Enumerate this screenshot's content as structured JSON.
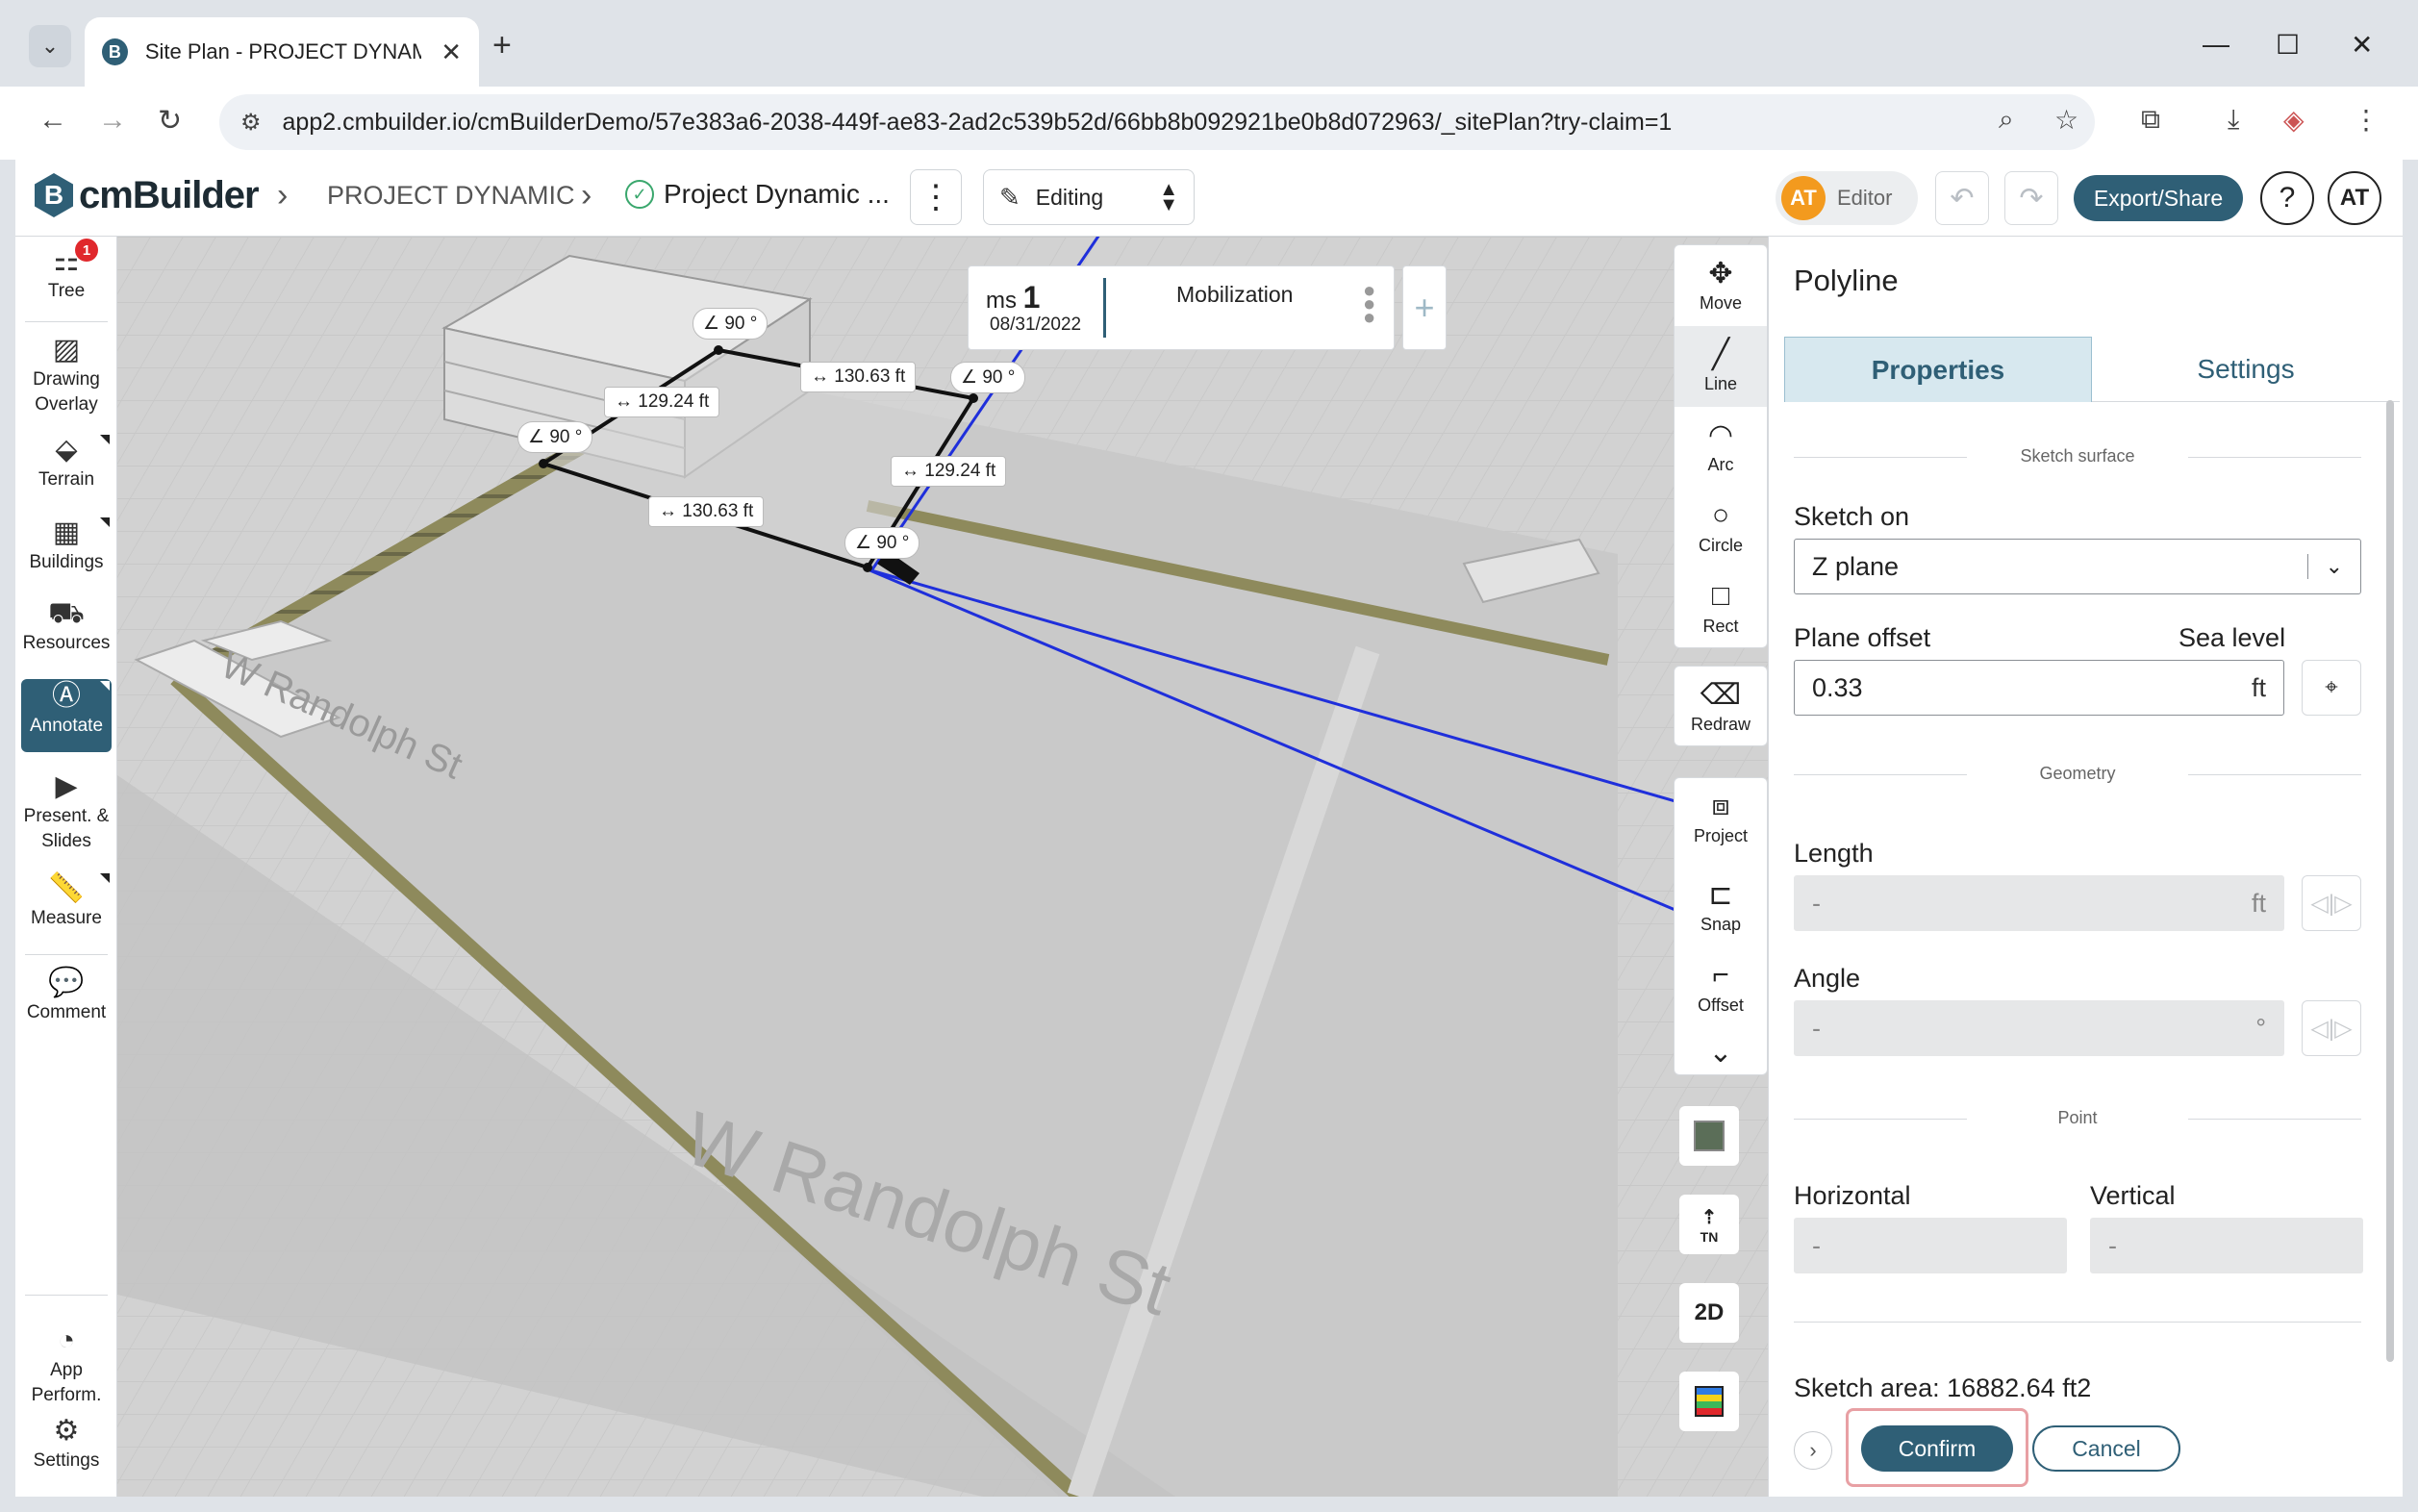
{
  "browser": {
    "tab_title": "Site Plan - PROJECT DYNAMIC |",
    "url": "app2.cmbuilder.io/cmBuilderDemo/57e383a6-2038-449f-ae83-2ad2c539b52d/66bb8b092921be0b8d072963/_sitePlan?try-claim=1"
  },
  "header": {
    "logo_text": "cmBuilder",
    "breadcrumb_project": "PROJECT DYNAMIC",
    "breadcrumb_plan": "Project Dynamic ...",
    "mode": "Editing",
    "user_initials": "AT",
    "role": "Editor",
    "export_label": "Export/Share",
    "help": "?",
    "profile_initials": "AT"
  },
  "sidebar": {
    "tree_badge": "1",
    "items": [
      {
        "label": "Tree",
        "icon": "tree-icon"
      },
      {
        "label": "Drawing Overlay",
        "icon": "image-icon"
      },
      {
        "label": "Terrain",
        "icon": "terrain-icon"
      },
      {
        "label": "Buildings",
        "icon": "buildings-icon"
      },
      {
        "label": "Resources",
        "icon": "resources-icon"
      },
      {
        "label": "Annotate",
        "icon": "annotate-icon"
      },
      {
        "label": "Present. & Slides",
        "icon": "presentation-icon"
      },
      {
        "label": "Measure",
        "icon": "ruler-icon"
      },
      {
        "label": "Comment",
        "icon": "comment-icon"
      },
      {
        "label": "App Perform.",
        "icon": "gauge-icon"
      },
      {
        "label": "Settings",
        "icon": "gear-icon"
      }
    ]
  },
  "milestone": {
    "prefix": "ms",
    "number": "1",
    "date": "08/31/2022",
    "name": "Mobilization"
  },
  "tools": {
    "move": "Move",
    "line": "Line",
    "arc": "Arc",
    "circle": "Circle",
    "rect": "Rect",
    "redraw": "Redraw",
    "project": "Project",
    "snap": "Snap",
    "offset": "Offset",
    "view_2d": "2D",
    "north": "TN"
  },
  "viewport": {
    "streets": [
      "W Randolph St",
      "W Randolph St"
    ],
    "measures": {
      "dim_top": "130.63 ft",
      "dim_left": "129.24 ft",
      "dim_right": "129.24 ft",
      "dim_bottom": "130.63 ft",
      "angle_top": "90 °",
      "angle_left": "90 °",
      "angle_right": "90 °",
      "angle_bottom": "90 °"
    }
  },
  "panel": {
    "title": "Polyline",
    "tab_properties": "Properties",
    "tab_settings": "Settings",
    "section_surface": "Sketch surface",
    "sketch_on_label": "Sketch on",
    "sketch_on_value": "Z plane",
    "plane_offset_label": "Plane offset",
    "sea_level_label": "Sea level",
    "plane_offset_value": "0.33",
    "unit_ft": "ft",
    "section_geometry": "Geometry",
    "length_label": "Length",
    "length_value": "-",
    "angle_label": "Angle",
    "angle_value": "-",
    "angle_unit": "°",
    "section_point": "Point",
    "horizontal_label": "Horizontal",
    "horizontal_value": "-",
    "vertical_label": "Vertical",
    "vertical_value": "-",
    "sketch_area": "Sketch area: 16882.64 ft2",
    "confirm": "Confirm",
    "cancel": "Cancel"
  }
}
